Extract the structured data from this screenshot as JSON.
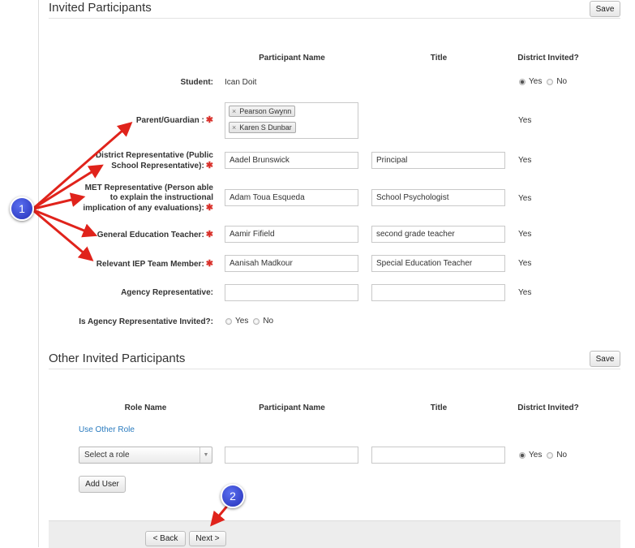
{
  "invited": {
    "title": "Invited Participants",
    "save_label": "Save",
    "headers": {
      "participant_name": "Participant Name",
      "title": "Title",
      "district_invited": "District Invited?"
    },
    "student": {
      "label": "Student:",
      "name": "Ican Doit",
      "yes": "Yes",
      "no": "No",
      "selected": "Yes"
    },
    "parent": {
      "label": "Parent/Guardian :",
      "required": "✱",
      "tags": [
        "Pearson Gwynn",
        "Karen S Dunbar"
      ],
      "remove_glyph": "×",
      "invited": "Yes"
    },
    "rows": [
      {
        "label_lines": [
          "District Representative (Public",
          "School Representative):"
        ],
        "name": "Aadel Brunswick",
        "title": "Principal",
        "invited": "Yes",
        "required": true
      },
      {
        "label_lines": [
          "MET Representative (Person able",
          "to explain the instructional",
          "implication of any evaluations):"
        ],
        "name": "Adam Toua Esqueda",
        "title": "School Psychologist",
        "invited": "Yes",
        "required": true
      },
      {
        "label_lines": [
          "General Education Teacher:"
        ],
        "name": "Aamir Fifield",
        "title": "second grade teacher",
        "invited": "Yes",
        "required": true
      },
      {
        "label_lines": [
          "Relevant IEP Team Member:"
        ],
        "name": "Aanisah Madkour",
        "title": "Special Education Teacher",
        "invited": "Yes",
        "required": true
      },
      {
        "label_lines": [
          "Agency Representative:"
        ],
        "name": "",
        "title": "",
        "invited": "Yes",
        "required": false
      }
    ],
    "agency_invited": {
      "label": "Is Agency Representative Invited?:",
      "yes": "Yes",
      "no": "No"
    }
  },
  "other": {
    "title": "Other Invited Participants",
    "save_label": "Save",
    "headers": {
      "role_name": "Role Name",
      "participant_name": "Participant Name",
      "title": "Title",
      "district_invited": "District Invited?"
    },
    "use_other_role": "Use Other Role",
    "role_select": "Select a role",
    "yes": "Yes",
    "no": "No",
    "selected": "Yes",
    "add_user": "Add User"
  },
  "footer": {
    "back": "< Back",
    "next": "Next >"
  },
  "callouts": [
    "1",
    "2"
  ],
  "colors": {
    "arrow": "#e0231b",
    "callout": "#2b36c2",
    "link": "#2a7bbf",
    "required": "#d9312b"
  }
}
